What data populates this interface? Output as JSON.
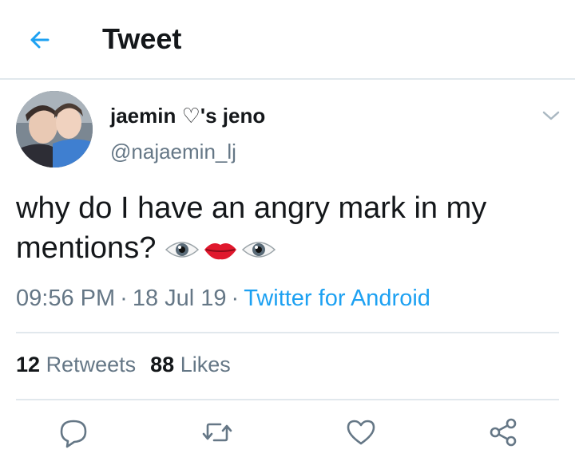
{
  "header": {
    "title": "Tweet",
    "back_icon": "arrow-left-icon"
  },
  "tweet": {
    "display_name": "jaemin ♡'s jeno",
    "handle": "@najaemin_lj",
    "text": "why do I have an angry mark in my mentions?",
    "emojis": [
      "eye-emoji",
      "lips-emoji",
      "eye-emoji"
    ],
    "time": "09:56 PM",
    "date": "18 Jul 19",
    "source": "Twitter for Android"
  },
  "stats": {
    "retweets_count": "12",
    "retweets_label": "Retweets",
    "likes_count": "88",
    "likes_label": "Likes"
  },
  "actions": [
    "reply-icon",
    "retweet-icon",
    "like-icon",
    "share-icon"
  ],
  "colors": {
    "accent": "#1da1f2",
    "secondary_text": "#657786",
    "divider": "#e1e8ed"
  }
}
